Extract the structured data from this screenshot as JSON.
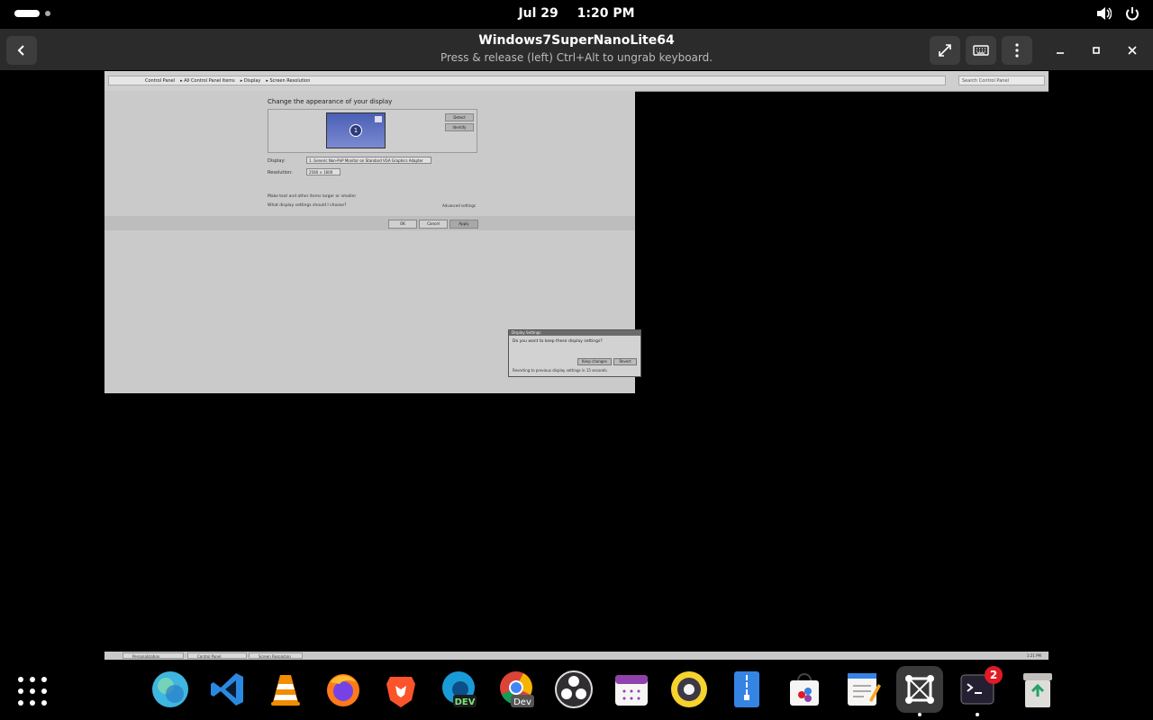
{
  "topbar": {
    "date": "Jul 29",
    "time": "1:20 PM"
  },
  "window": {
    "title": "Windows7SuperNanoLite64",
    "subtitle": "Press & release (left) Ctrl+Alt to ungrab keyboard."
  },
  "vm": {
    "breadcrumbs": [
      "Control Panel",
      "All Control Panel Items",
      "Display",
      "Screen Resolution"
    ],
    "search_placeholder": "Search Control Panel",
    "heading": "Change the appearance of your display",
    "monitor_number": "1",
    "detect_label": "Detect",
    "identify_label": "Identify",
    "display_label": "Display:",
    "display_value": "1. Generic Non-PnP Monitor on Standard VGA Graphics Adapter",
    "resolution_label": "Resolution:",
    "resolution_value": "2560 × 1600",
    "advanced_label": "Advanced settings",
    "link1": "Make text and other items larger or smaller",
    "link2": "What display settings should I choose?",
    "ok_label": "OK",
    "cancel_label": "Cancel",
    "apply_label": "Apply",
    "dialog": {
      "title": "Display Settings",
      "question": "Do you want to keep these display settings?",
      "keep_label": "Keep changes",
      "revert_label": "Revert",
      "footer": "Reverting to previous display settings in 15 seconds."
    },
    "taskbar": {
      "items": [
        "Personalization",
        "Control Panel",
        "Screen Resolution"
      ],
      "clock": "1:21 PM"
    }
  },
  "dock": {
    "apps": [
      "show-apps",
      "web-browser",
      "vscode",
      "vlc",
      "firefox",
      "brave",
      "edge-dev",
      "chrome-dev",
      "obs",
      "calendar",
      "rhythmbox",
      "file-roller",
      "software-center",
      "text-editor",
      "gnome-boxes",
      "terminal",
      "trash"
    ],
    "terminal_badge": "2"
  }
}
